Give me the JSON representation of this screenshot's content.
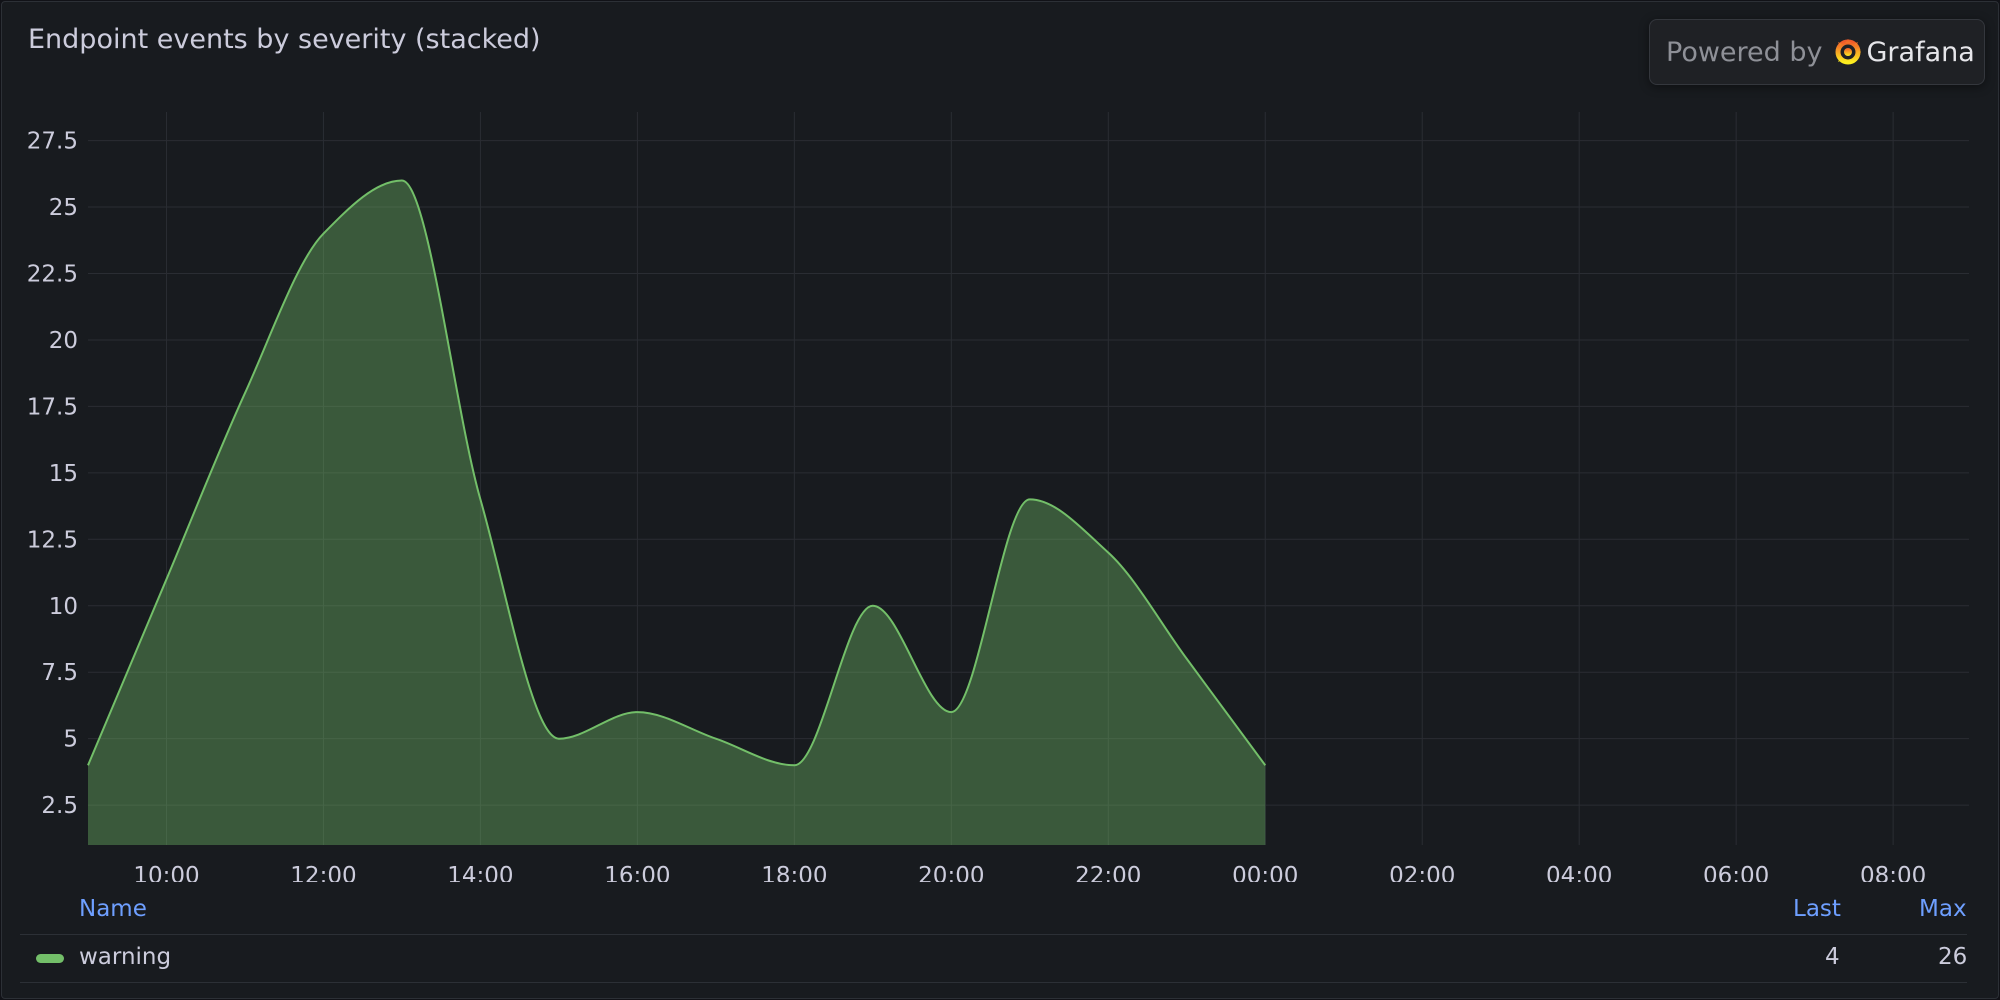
{
  "panel": {
    "title": "Endpoint events by severity (stacked)",
    "powered_by": "Powered by",
    "brand": "Grafana"
  },
  "chart_data": {
    "type": "area",
    "title": "Endpoint events by severity (stacked)",
    "stacked": true,
    "x": [
      "09:00",
      "10:00",
      "11:00",
      "12:00",
      "13:00",
      "14:00",
      "15:00",
      "16:00",
      "17:00",
      "18:00",
      "19:00",
      "20:00",
      "21:00",
      "22:00",
      "23:00",
      "00:00"
    ],
    "x_ticks": [
      "10:00",
      "12:00",
      "14:00",
      "16:00",
      "18:00",
      "20:00",
      "22:00",
      "00:00",
      "02:00",
      "04:00",
      "06:00",
      "08:00"
    ],
    "x_range": [
      "09:00",
      "08:58 (next day)"
    ],
    "y_ticks": [
      "2.5",
      "5",
      "7.5",
      "10",
      "12.5",
      "15",
      "17.5",
      "20",
      "22.5",
      "25",
      "27.5"
    ],
    "ylim": [
      1,
      28.5
    ],
    "grid": true,
    "series": [
      {
        "name": "warning",
        "color": "#73bf69",
        "values": [
          4,
          11,
          18,
          24,
          26,
          14,
          5,
          6,
          5,
          4,
          10,
          6,
          14,
          12,
          8,
          4
        ]
      }
    ],
    "legend": {
      "placement": "bottom",
      "columns": [
        "Name",
        "Last",
        "Max"
      ],
      "rows": [
        {
          "name": "warning",
          "last": "4",
          "max": "26"
        }
      ]
    }
  }
}
